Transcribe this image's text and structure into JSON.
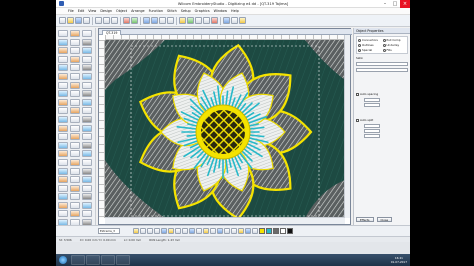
{
  "window": {
    "title": "Wilcom EmbroideryStudio - Digitizing e4 dd - [QT-319         Tajima]"
  },
  "menu": [
    "File",
    "Edit",
    "View",
    "Design",
    "Object",
    "Arrange",
    "Function",
    "Stitch",
    "Setup",
    "Graphics",
    "Window",
    "Help"
  ],
  "document": {
    "tab_label": "QT-319"
  },
  "object_properties": {
    "header": "Object Properties",
    "options": [
      {
        "label": "Connectors",
        "selected": false
      },
      {
        "label": "Pull Comp",
        "selected": true
      },
      {
        "label": "Outlines",
        "selected": false
      },
      {
        "label": "Underlay",
        "selected": false
      },
      {
        "label": "Special",
        "selected": true
      },
      {
        "label": "Fills",
        "selected": false
      }
    ],
    "section": "Satin",
    "auto_spacing": "Auto spacing",
    "auto_split": "Auto split",
    "effects_button": "Effects",
    "close_button": "Close"
  },
  "bottom_toolbar": {
    "combo_value": "Extrema_3",
    "swatch_colors": [
      "#f4e300",
      "#26b8c8",
      "#6a6a6a",
      "#ffffff",
      "#111111"
    ]
  },
  "status": {
    "stitches": "St: 3,506",
    "coords": "X= 0.00 mm  Y= 0.00 mm",
    "len": "L= 0.00 mm",
    "run": "RUN Length: 1.43 mm"
  },
  "taskbar": {
    "time": "16:41",
    "date": "01-07-2017"
  },
  "colors": {
    "canvas_bg": "#1d4a42",
    "yellow_thread": "#f4e300",
    "cyan_thread": "#26b8c8"
  }
}
